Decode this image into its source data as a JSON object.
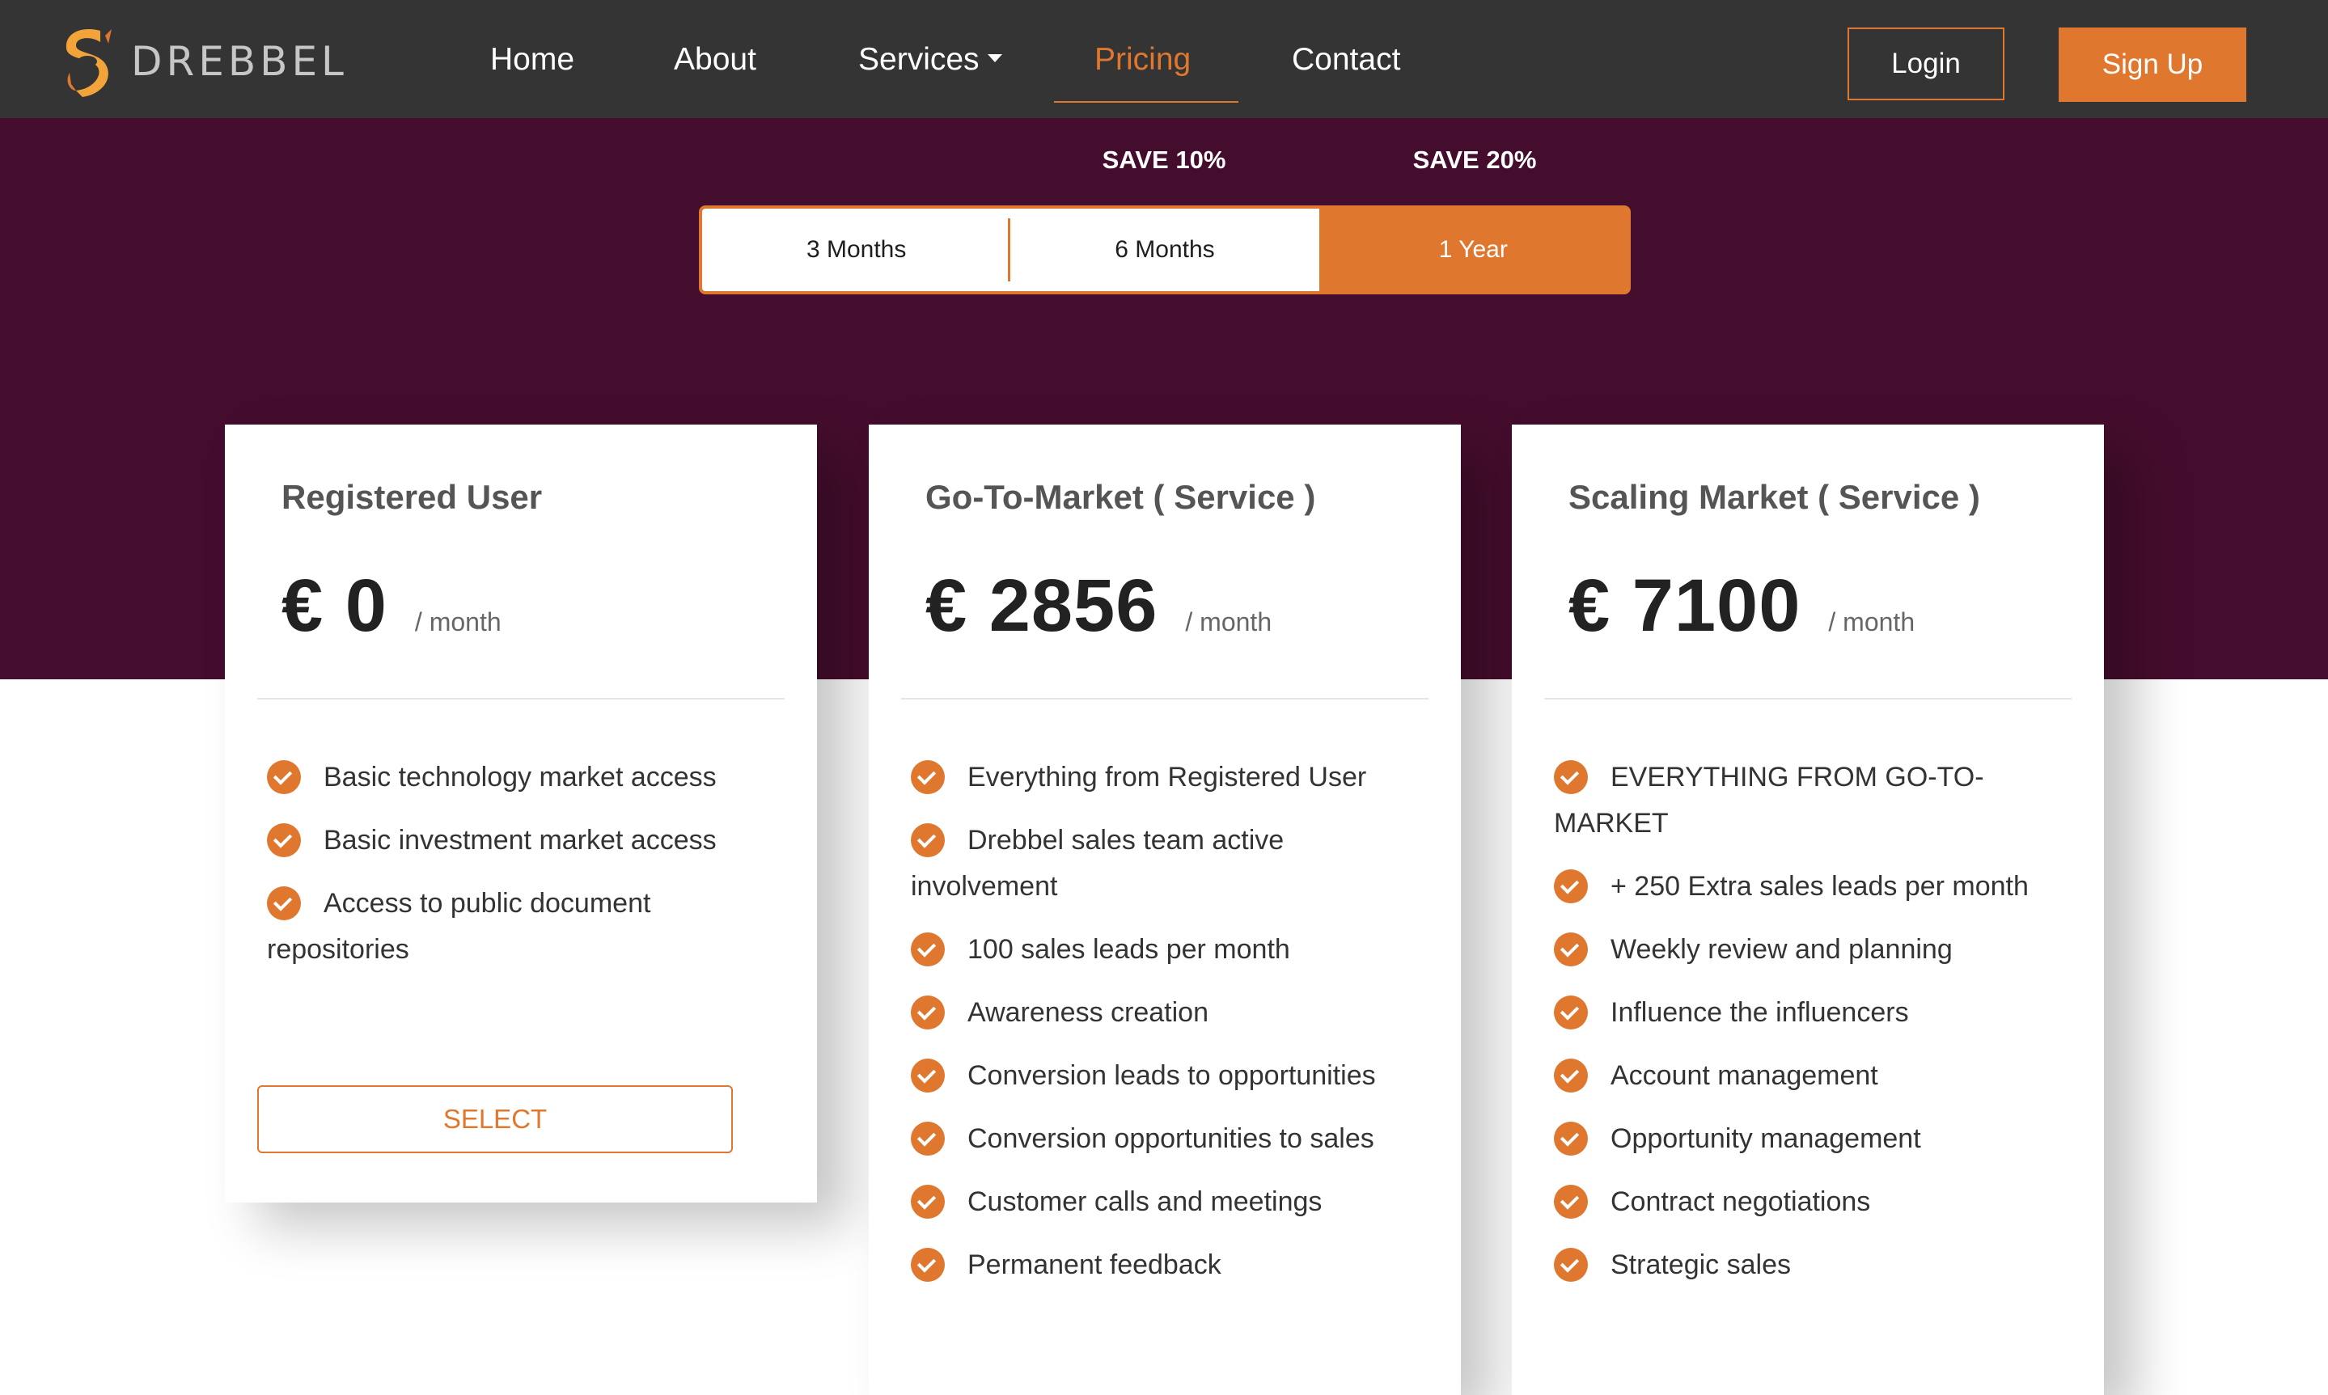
{
  "brand": {
    "name": "DREBBEL"
  },
  "nav": {
    "home": "Home",
    "about": "About",
    "services": "Services",
    "pricing": "Pricing",
    "contact": "Contact",
    "login": "Login",
    "signup": "Sign Up",
    "active_item": "Pricing"
  },
  "billing": {
    "save_6_months": "SAVE 10%",
    "save_1_year": "SAVE 20%",
    "options": [
      "3 Months",
      "6 Months",
      "1 Year"
    ],
    "selected": "1 Year"
  },
  "plans": [
    {
      "title": "Registered User",
      "price": "€ 0",
      "period": "/ month",
      "features": [
        "Basic technology market access",
        "Basic investment market access",
        "Access to public document repositories"
      ],
      "button": "SELECT"
    },
    {
      "title": "Go-To-Market ( Service )",
      "price": "€ 2856",
      "period": "/ month",
      "features": [
        "Everything from Registered User",
        "Drebbel sales team active involvement",
        "100 sales leads per month",
        "Awareness creation",
        "Conversion leads to opportunities",
        "Conversion opportunities to sales",
        "Customer calls and meetings",
        "Permanent feedback"
      ]
    },
    {
      "title": "Scaling Market ( Service )",
      "price": "€ 7100",
      "period": "/ month",
      "features": [
        "EVERYTHING FROM GO-TO-MARKET",
        "+ 250 Extra sales leads per month",
        "Weekly review and planning",
        "Influence the influencers",
        "Account management",
        "Opportunity management",
        "Contract negotiations",
        "Strategic sales"
      ]
    }
  ],
  "colors": {
    "accent": "#e0772e",
    "navbar": "#343434",
    "hero": "#450d2d"
  }
}
